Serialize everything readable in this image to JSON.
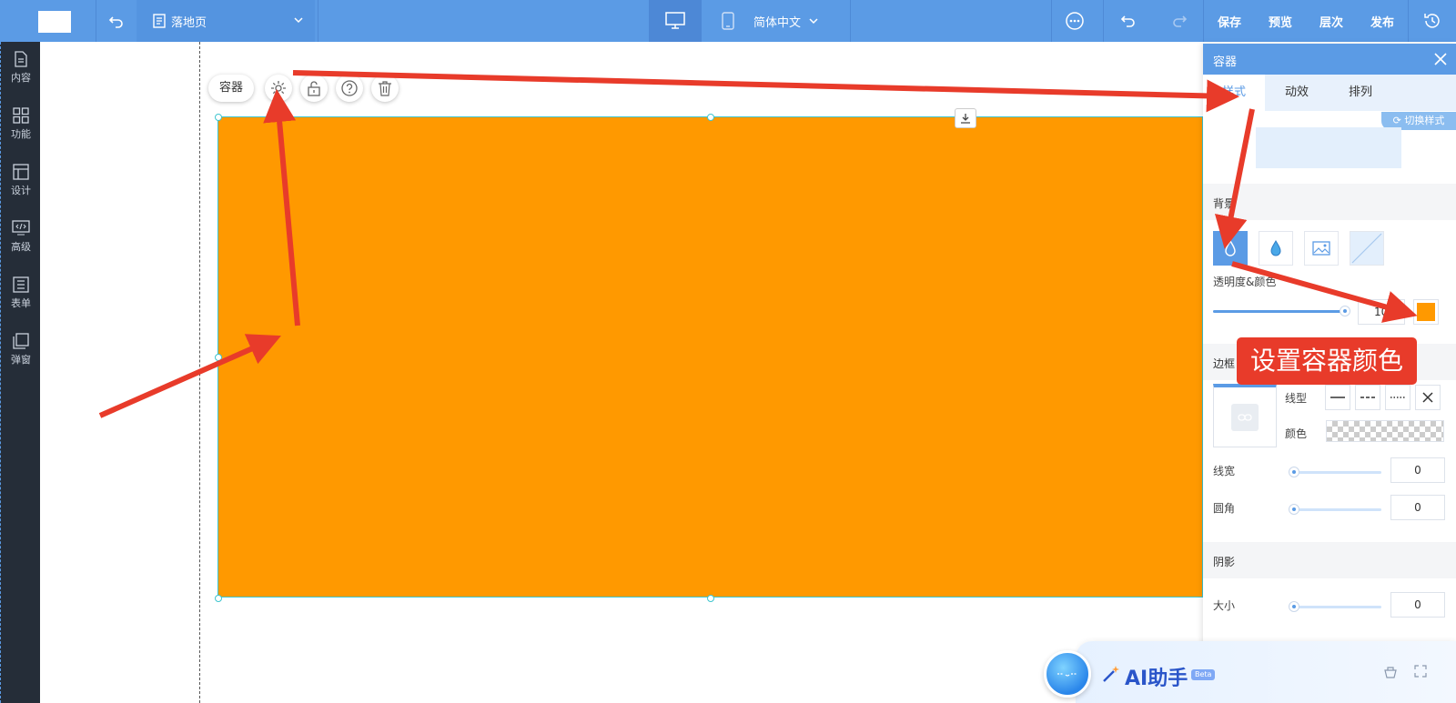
{
  "topbar": {
    "page_name": "落地页",
    "language": "简体中文",
    "buttons": {
      "save": "保存",
      "preview": "预览",
      "layers": "层次",
      "publish": "发布"
    }
  },
  "sidebar": {
    "items": [
      {
        "label": "内容",
        "icon": "file-icon"
      },
      {
        "label": "功能",
        "icon": "grid-icon"
      },
      {
        "label": "设计",
        "icon": "layout-icon"
      },
      {
        "label": "高级",
        "icon": "code-monitor-icon"
      },
      {
        "label": "表单",
        "icon": "form-icon"
      },
      {
        "label": "弹窗",
        "icon": "popup-icon"
      }
    ]
  },
  "canvas": {
    "element_tag": "容器",
    "container_color": "#ff9900"
  },
  "panel": {
    "title": "容器",
    "tabs": [
      "样式",
      "动效",
      "排列"
    ],
    "active_tab": 0,
    "switch_style": "切换样式",
    "background": {
      "section": "背景",
      "opacity_label": "透明度&颜色",
      "opacity_value": "100%",
      "opacity_fraction": 1.0,
      "color": "#ff9900"
    },
    "border": {
      "section": "边框",
      "line_type_label": "线型",
      "color_label": "颜色",
      "width_label": "线宽",
      "width_value": "0",
      "radius_label": "圆角",
      "radius_value": "0"
    },
    "shadow": {
      "section": "阴影",
      "size_label": "大小",
      "size_value": "0"
    }
  },
  "annotation": {
    "callout_text": "设置容器颜色",
    "arrow_color": "#e83b2a"
  },
  "ai_helper": {
    "label": "AI助手",
    "badge": "Beta"
  },
  "colors": {
    "primary": "#5b9be5",
    "sidebar_bg": "#252d38",
    "accent_orange": "#ff9900"
  }
}
